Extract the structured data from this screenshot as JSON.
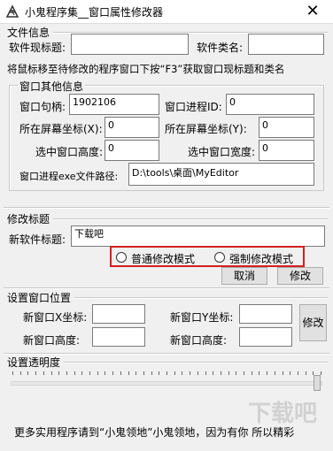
{
  "window": {
    "title": "小鬼程序集__窗口属性修改器",
    "close_glyph": "✕"
  },
  "file_info": {
    "group_title": "文件信息",
    "title_label": "软件现标题:",
    "title_value": "",
    "class_label": "软件类名:",
    "class_value": "",
    "hint": "将鼠标移至待修改的程序窗口下按“F3”获取窗口现标题和类名"
  },
  "window_info": {
    "group_title": "窗口其他信息",
    "handle_label": "窗口句柄:",
    "handle_value": "1902106",
    "pid_label": "窗口进程ID:",
    "pid_value": "0",
    "screen_x_label": "所在屏幕坐标(X):",
    "screen_x_value": "0",
    "screen_y_label": "所在屏幕坐标(Y):",
    "screen_y_value": "0",
    "height_label": "选中窗口高度:",
    "height_value": "0",
    "width_label": "选中窗口宽度:",
    "width_value": "0",
    "exe_label": "窗口进程exe文件路径:",
    "exe_value": "D:\\tools\\桌面\\MyEditor"
  },
  "modify_title": {
    "group_title": "修改标题",
    "new_title_label": "新软件标题:",
    "new_title_value": "下载吧",
    "mode_normal": "普通修改模式",
    "mode_force": "强制修改模式",
    "cancel_label": "取消",
    "modify_label": "修改"
  },
  "position": {
    "group_title": "设置窗口位置",
    "x_label": "新窗口X坐标:",
    "x_value": "",
    "y_label": "新窗口Y坐标:",
    "y_value": "",
    "h_label": "新窗口高度:",
    "h_value": "",
    "w_label": "新窗口高度:",
    "w_value": "",
    "modify_label": "修改"
  },
  "transparency": {
    "group_title": "设置透明度",
    "level": 1.0
  },
  "footer": {
    "text": "更多实用程序请到“小鬼领地”小鬼领地，因为有你 所以精彩"
  },
  "watermark": {
    "text": "下载吧"
  },
  "colors": {
    "highlight": "#d41f1f",
    "background": "#f0f0f0"
  }
}
